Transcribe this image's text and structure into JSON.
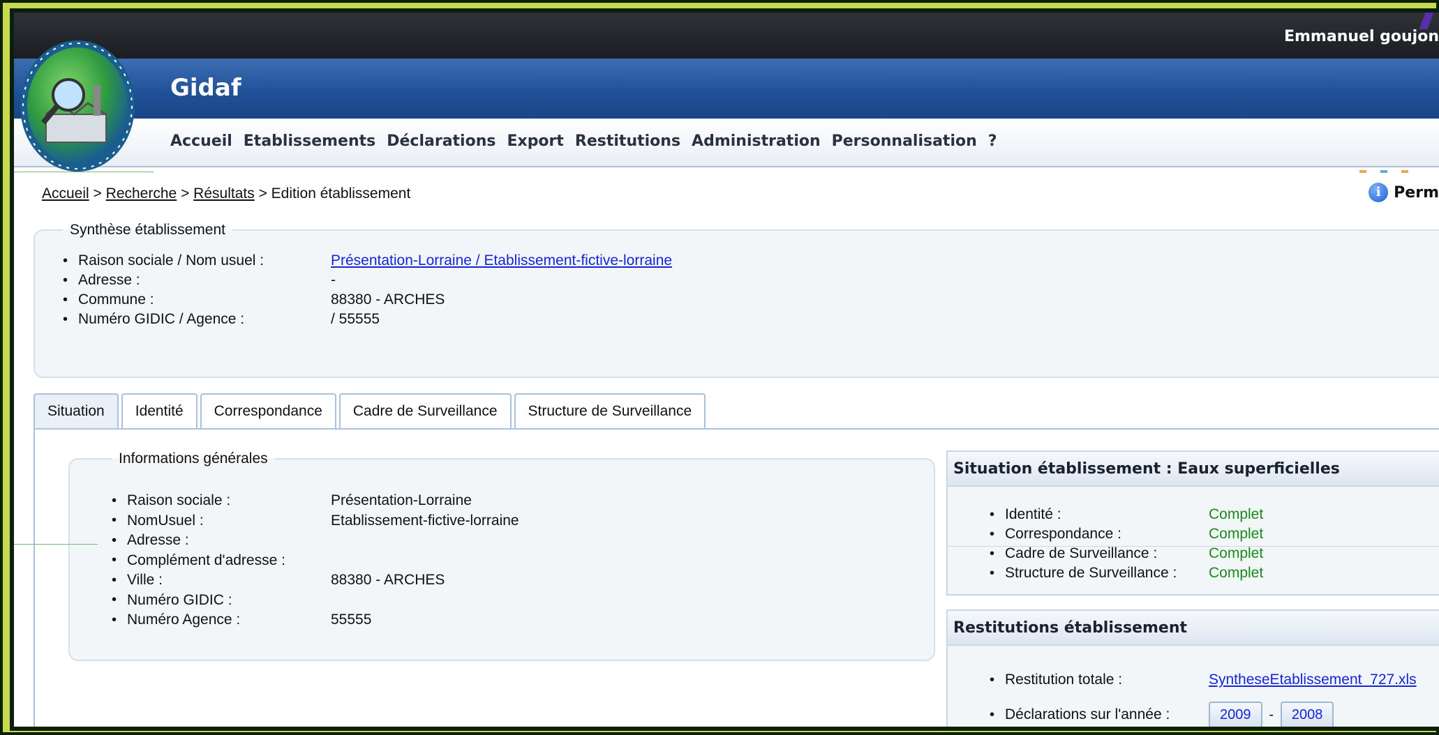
{
  "header": {
    "user_name": "Emmanuel goujon",
    "app_title": "Gidaf"
  },
  "nav": {
    "items": [
      "Accueil",
      "Etablissements",
      "Déclarations",
      "Export",
      "Restitutions",
      "Administration",
      "Personnalisation",
      "?"
    ]
  },
  "breadcrumb": {
    "items": [
      "Accueil",
      "Recherche",
      "Résultats"
    ],
    "current": "Edition établissement",
    "separator": ">"
  },
  "perm_label": "Perm",
  "synthese": {
    "legend": "Synthèse établissement",
    "rows": [
      {
        "label": "Raison sociale / Nom usuel :",
        "value": "Présentation-Lorraine / Etablissement-fictive-lorraine"
      },
      {
        "label": "Adresse :",
        "value": "-"
      },
      {
        "label": "Commune :",
        "value": "88380 - ARCHES"
      },
      {
        "label": "Numéro GIDIC / Agence :",
        "value": "/ 55555"
      }
    ]
  },
  "tabs": [
    "Situation",
    "Identité",
    "Correspondance",
    "Cadre de Surveillance",
    "Structure de Surveillance"
  ],
  "info_generales": {
    "legend": "Informations générales",
    "rows": [
      {
        "label": "Raison sociale :",
        "value": "Présentation-Lorraine"
      },
      {
        "label": "NomUsuel :",
        "value": "Etablissement-fictive-lorraine"
      },
      {
        "label": "Adresse :",
        "value": ""
      },
      {
        "label": "Complément d'adresse :",
        "value": ""
      },
      {
        "label": "Ville :",
        "value": "88380 - ARCHES"
      },
      {
        "label": "Numéro GIDIC :",
        "value": ""
      },
      {
        "label": "Numéro Agence :",
        "value": "55555"
      }
    ]
  },
  "situation": {
    "title": "Situation établissement : Eaux superficielles",
    "rows": [
      {
        "label": "Identité :",
        "value": "Complet"
      },
      {
        "label": "Correspondance :",
        "value": "Complet"
      },
      {
        "label": "Cadre de Surveillance :",
        "value": "Complet"
      },
      {
        "label": "Structure de Surveillance :",
        "value": "Complet"
      }
    ],
    "status_color": "#1a8a1a"
  },
  "restitutions": {
    "title": "Restitutions établissement",
    "total_label": "Restitution totale :",
    "total_file": "SyntheseEtablissement_727.xls",
    "years_label": "Déclarations sur l'année :",
    "year_1": "2009",
    "year_sep": "-",
    "year_2": "2008"
  },
  "colors": {
    "header_blue": "#1f4f96",
    "link_blue": "#1525d6",
    "frame_green": "#c7d94f"
  }
}
